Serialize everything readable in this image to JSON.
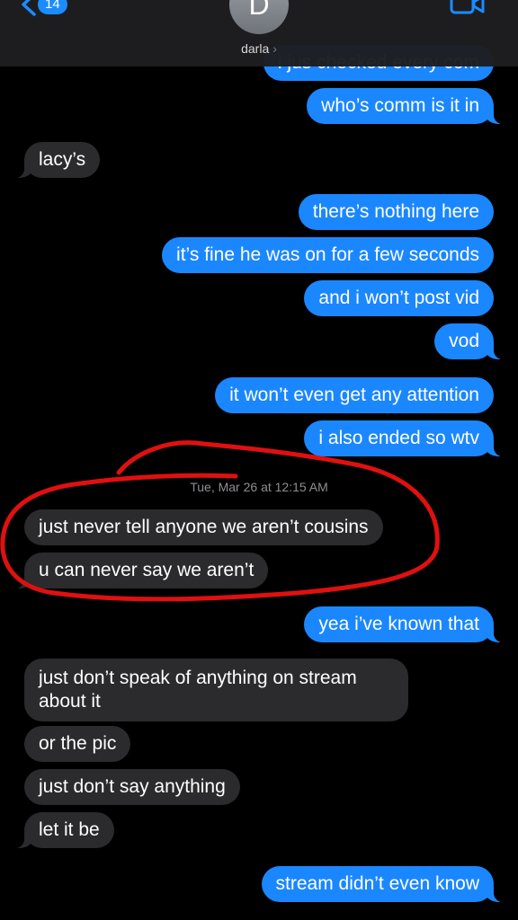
{
  "header": {
    "back_count": "14",
    "avatar_initial": "D",
    "contact_name": "darla",
    "contact_chevron": "›"
  },
  "messages": [
    {
      "dir": "sent",
      "text": "i jus checked every com"
    },
    {
      "dir": "sent",
      "text": "who’s comm is it in"
    },
    {
      "dir": "recv",
      "text": "lacy’s"
    },
    {
      "dir": "sent",
      "text": "there’s nothing here"
    },
    {
      "dir": "sent",
      "text": "it’s fine he was on for a few seconds"
    },
    {
      "dir": "sent",
      "text": "and i won’t post vid"
    },
    {
      "dir": "sent",
      "text": "vod"
    },
    {
      "dir": "sent",
      "text": "it won’t even get any attention"
    },
    {
      "dir": "sent",
      "text": "i also ended so wtv"
    },
    {
      "dir": "recv",
      "text": "just never tell anyone we aren’t cousins"
    },
    {
      "dir": "recv",
      "text": "u can never say we aren’t"
    },
    {
      "dir": "sent",
      "text": "yea i’ve known that"
    },
    {
      "dir": "recv",
      "text": "just don’t speak of anything on stream about it"
    },
    {
      "dir": "recv",
      "text": "or the pic"
    },
    {
      "dir": "recv",
      "text": "just don’t say anything"
    },
    {
      "dir": "recv",
      "text": "let it be"
    },
    {
      "dir": "sent",
      "text": "stream didn’t even know"
    }
  ],
  "timestamp": "Tue, Mar 26 at 12:15 AM",
  "colors": {
    "sent_bubble": "#1b87ff",
    "recv_bubble": "#2b2b2d",
    "background": "#000000",
    "annotation": "#e01010"
  },
  "icons": {
    "back": "chevron-left-icon",
    "facetime": "video-camera-icon"
  }
}
